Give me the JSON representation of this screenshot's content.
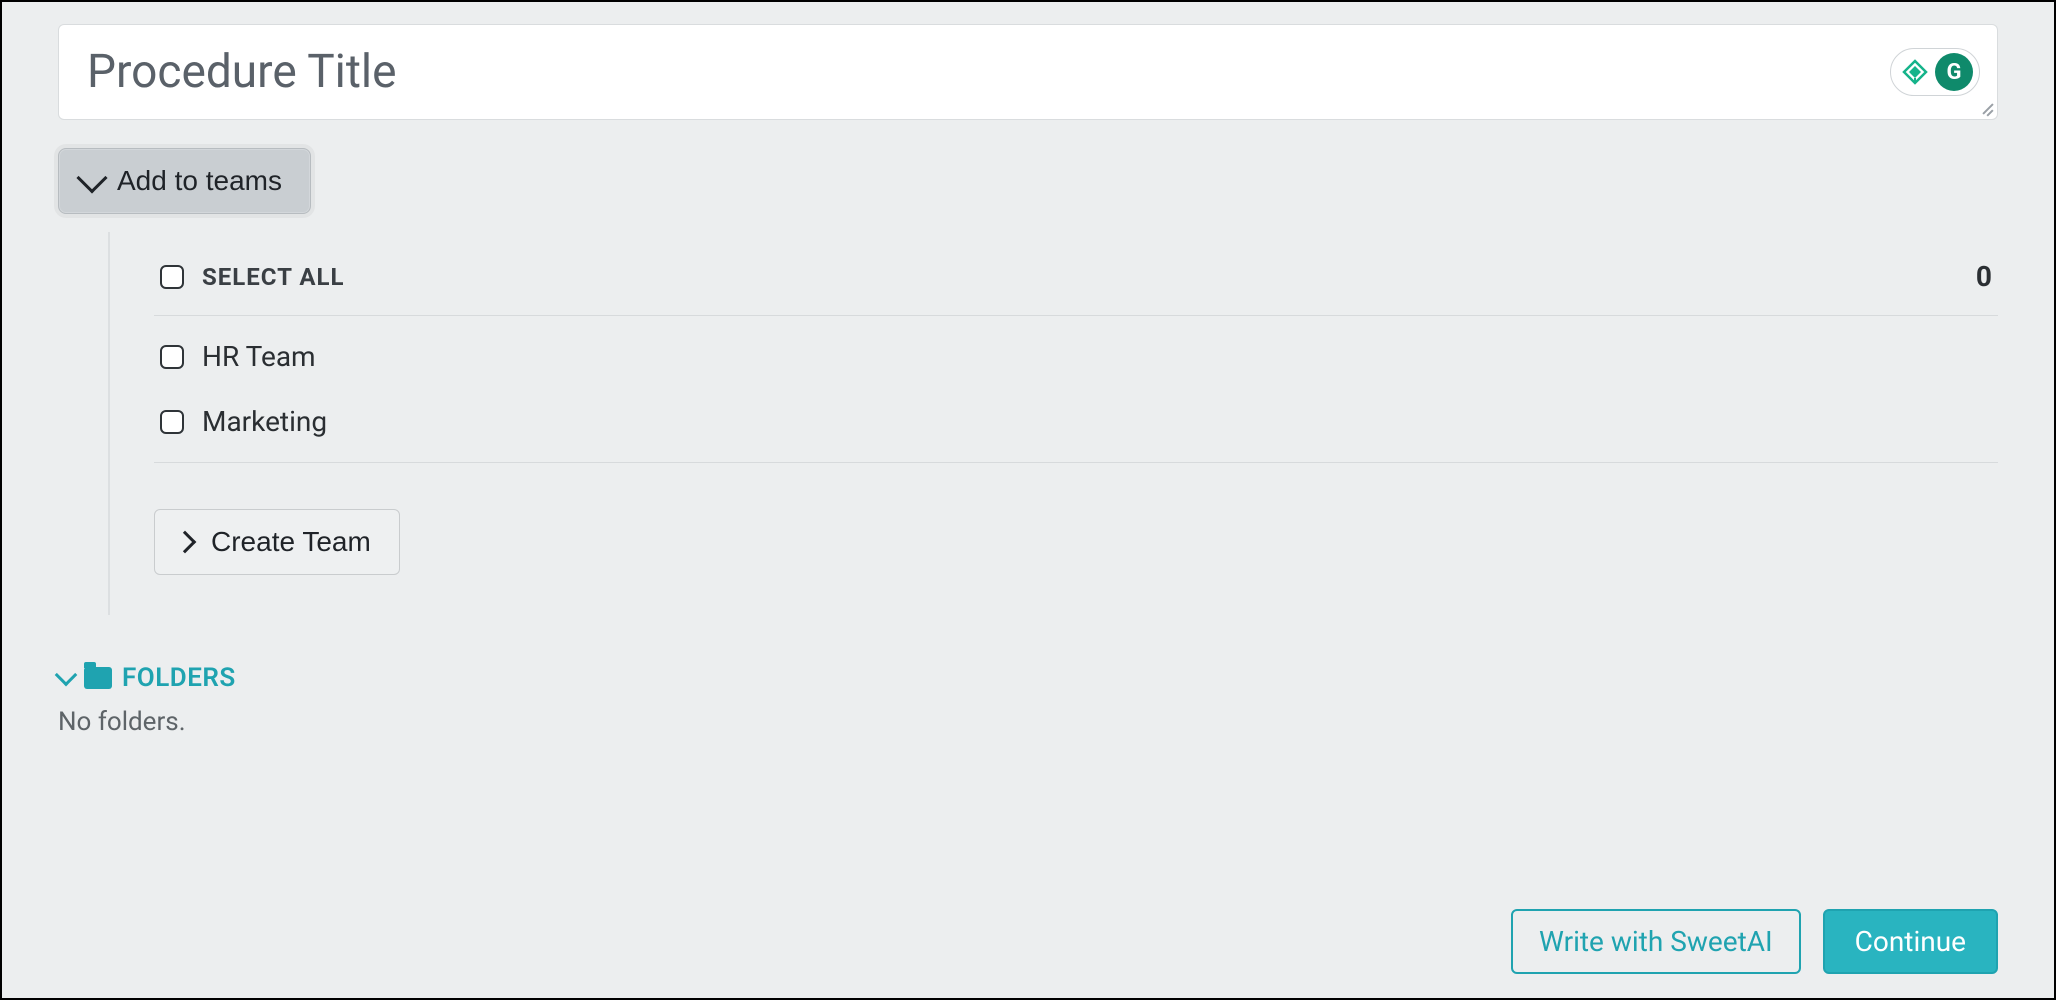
{
  "title": {
    "placeholder": "Procedure Title",
    "value": ""
  },
  "grammarly": {
    "letter": "G"
  },
  "teams_section": {
    "toggle_label": "Add to teams",
    "select_all_label": "Select All",
    "selected_count": "0",
    "teams": [
      {
        "label": "HR Team"
      },
      {
        "label": "Marketing"
      }
    ],
    "create_team_label": "Create Team"
  },
  "folders_section": {
    "header_label": "FOLDERS",
    "empty_text": "No folders."
  },
  "actions": {
    "write_with_ai": "Write with SweetAI",
    "continue": "Continue"
  }
}
